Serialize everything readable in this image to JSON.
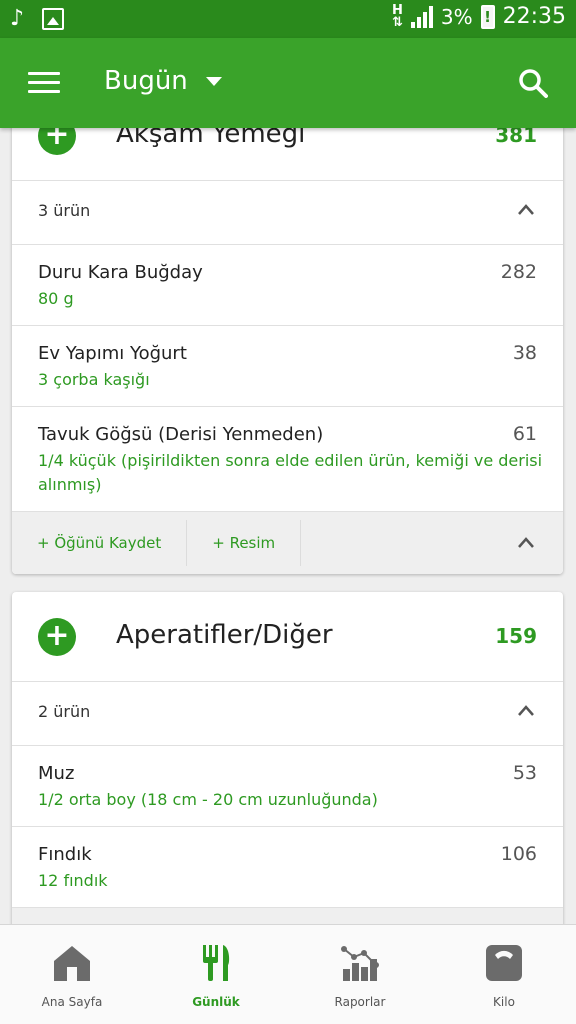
{
  "status_bar": {
    "network": "H",
    "battery": "3%",
    "battery_warning": "!",
    "time": "22:35",
    "icons": [
      "music-note-icon",
      "image-icon",
      "signal-icon",
      "battery-icon"
    ]
  },
  "appbar": {
    "title": "Bugün",
    "icons": [
      "menu-icon",
      "search-icon"
    ]
  },
  "meals": [
    {
      "name": "Akşam Yemeği",
      "kcal": "381",
      "count": "3 ürün",
      "items": [
        {
          "name": "Duru Kara Buğday",
          "portion": "80 g",
          "kcal": "282"
        },
        {
          "name": "Ev Yapımı Yoğurt",
          "portion": "3 çorba kaşığı",
          "kcal": "38"
        },
        {
          "name": "Tavuk Göğsü (Derisi Yenmeden)",
          "portion": "1/4 küçük (pişirildikten sonra elde edilen ürün, kemiği ve derisi alınmış)",
          "kcal": "61"
        }
      ],
      "footer": {
        "save_label": "+ Öğünü Kaydet",
        "photo_label": "+ Resim"
      }
    },
    {
      "name": "Aperatifler/Diğer",
      "kcal": "159",
      "count": "2 ürün",
      "items": [
        {
          "name": "Muz",
          "portion": "1/2 orta boy (18 cm - 20 cm uzunluğunda)",
          "kcal": "53"
        },
        {
          "name": "Fındık",
          "portion": "12 fındık",
          "kcal": "106"
        }
      ]
    }
  ],
  "bottom_nav": [
    {
      "label": "Ana Sayfa",
      "icon": "home-icon",
      "active": false
    },
    {
      "label": "Günlük",
      "icon": "fork-knife-icon",
      "active": true
    },
    {
      "label": "Raporlar",
      "icon": "chart-icon",
      "active": false
    },
    {
      "label": "Kilo",
      "icon": "scale-icon",
      "active": false
    }
  ],
  "colors": {
    "statusbar": "#2a8a1c",
    "appbar": "#3aa32a",
    "accent": "#2e9a22"
  }
}
